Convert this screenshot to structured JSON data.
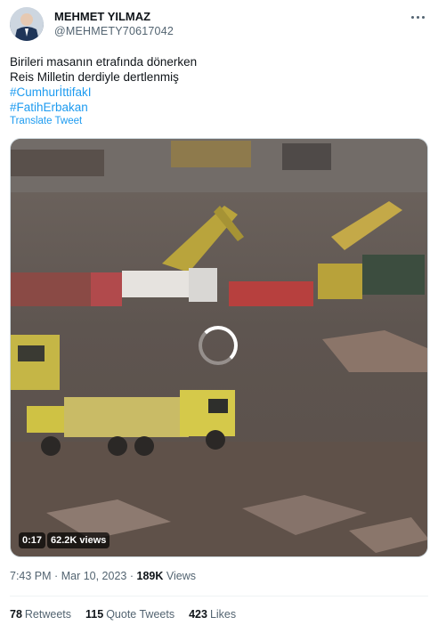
{
  "author": {
    "name": "MEHMET YILMAZ",
    "handle": "@MEHMETY70617042"
  },
  "tweet": {
    "lines": [
      "Birileri masanın etrafında dönerken",
      "Reis Milletin derdiyle dertlenmiş"
    ],
    "hashtags": [
      "#CumhurİttifakI",
      "#FatihErbakan"
    ],
    "translate_label": "Translate Tweet"
  },
  "media": {
    "duration": "0:17",
    "views": "62.2K views"
  },
  "meta": {
    "time": "7:43 PM",
    "separator": "·",
    "date": "Mar 10, 2023",
    "views_count": "189K",
    "views_label": "Views"
  },
  "stats": {
    "retweets_count": "78",
    "retweets_label": "Retweets",
    "quotes_count": "115",
    "quotes_label": "Quote Tweets",
    "likes_count": "423",
    "likes_label": "Likes"
  },
  "icons": {
    "more": "more-dots-icon",
    "loading": "loading-spinner-icon"
  },
  "colors": {
    "link": "#1d9bf0",
    "muted": "#536471",
    "text": "#0f1419"
  }
}
